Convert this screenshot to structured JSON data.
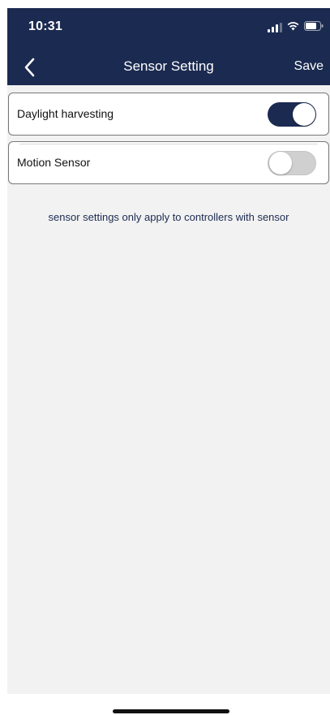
{
  "status_bar": {
    "time": "10:31"
  },
  "nav": {
    "title": "Sensor Setting",
    "save_label": "Save"
  },
  "settings": [
    {
      "label": "Daylight harvesting",
      "enabled": true
    },
    {
      "label": "Motion Sensor",
      "enabled": false
    }
  ],
  "note": "sensor settings only apply to controllers with sensor",
  "colors": {
    "primary": "#1b2a50",
    "background": "#f2f2f2",
    "toggle_off": "#d0d0d0"
  }
}
